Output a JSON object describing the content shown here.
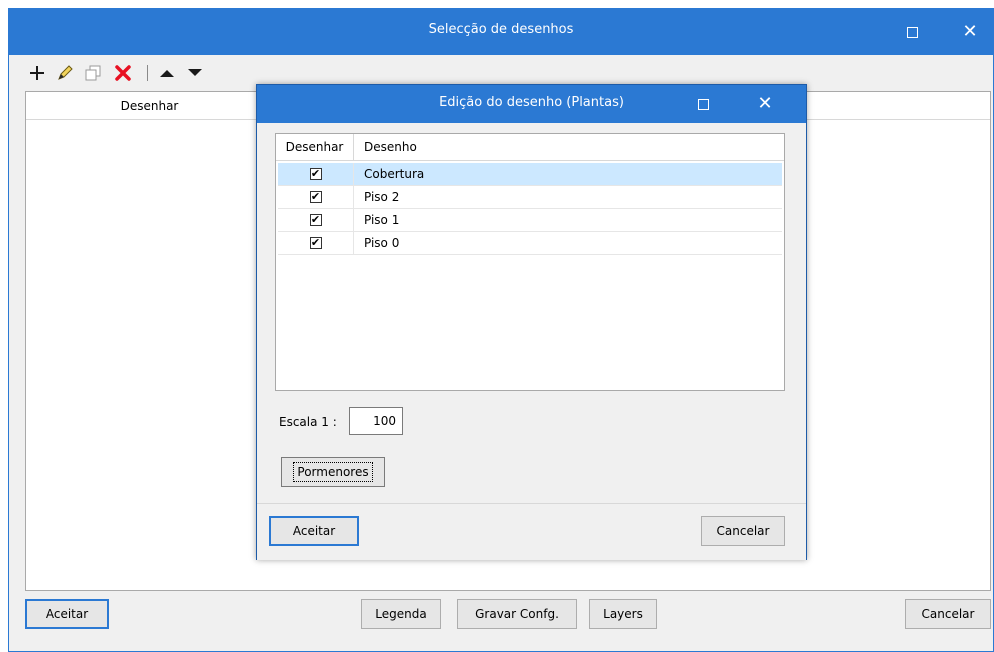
{
  "main": {
    "title": "Selecção de desenhos",
    "list_header": "Desenhar",
    "buttons": {
      "accept": "Aceitar",
      "legend": "Legenda",
      "save_config": "Gravar Confg.",
      "layers": "Layers",
      "cancel": "Cancelar"
    },
    "toolbar_icons": [
      "add-icon",
      "edit-pencil-icon",
      "copy-icon",
      "delete-icon",
      "move-up-icon",
      "move-down-icon"
    ]
  },
  "dialog": {
    "title": "Edição do desenho (Plantas)",
    "columns": {
      "draw": "Desenhar",
      "drawing": "Desenho"
    },
    "rows": [
      {
        "name": "Cobertura",
        "checked": true,
        "selected": true
      },
      {
        "name": "Piso 2",
        "checked": true,
        "selected": false
      },
      {
        "name": "Piso 1",
        "checked": true,
        "selected": false
      },
      {
        "name": "Piso 0",
        "checked": true,
        "selected": false
      }
    ],
    "scale_label": "Escala  1 :",
    "scale_value": "100",
    "details_button": "Pormenores",
    "accept": "Aceitar",
    "cancel": "Cancelar",
    "checkmark": "✔"
  },
  "colors": {
    "accent": "#2b79d3",
    "selection": "#cce8ff",
    "delete_red": "#e81123"
  }
}
